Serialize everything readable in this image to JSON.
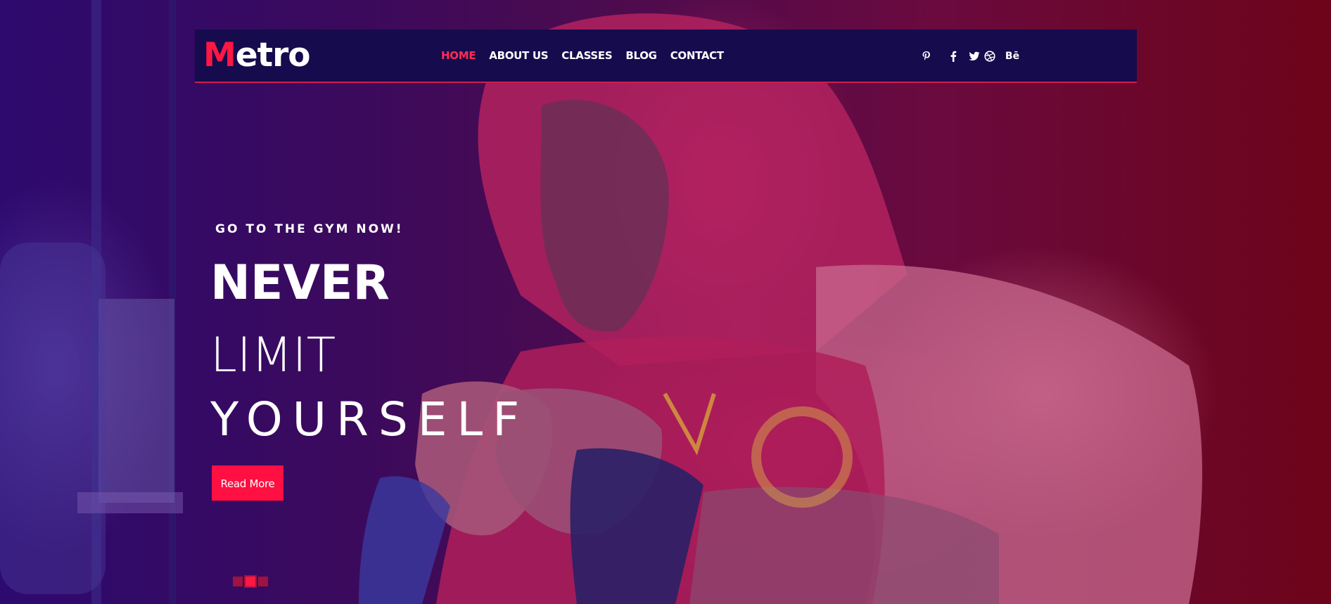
{
  "logo": {
    "first_letter": "M",
    "rest": "etro"
  },
  "nav": {
    "items": [
      {
        "label": "HOME",
        "active": true
      },
      {
        "label": "ABOUT US",
        "active": false
      },
      {
        "label": "CLASSES",
        "active": false
      },
      {
        "label": "BLOG",
        "active": false
      },
      {
        "label": "CONTACT",
        "active": false
      }
    ]
  },
  "socials": [
    {
      "icon": "pinterest-icon"
    },
    {
      "icon": "facebook-icon"
    },
    {
      "icon": "twitter-icon"
    },
    {
      "icon": "dribbble-icon"
    },
    {
      "icon": "behance-icon",
      "label": "Bē"
    }
  ],
  "hero": {
    "kicker": "GO TO THE GYM NOW!",
    "line1": "NEVER",
    "line2": "LIMIT",
    "line3": "YOURSELF",
    "button_label": "Read More"
  },
  "slider": {
    "count": 3,
    "active_index": 1
  },
  "colors": {
    "accent": "#ff1744",
    "navbar_bg": "#160b4c",
    "button_bg": "#ff0f42",
    "dot_inactive": "#a0123f"
  }
}
